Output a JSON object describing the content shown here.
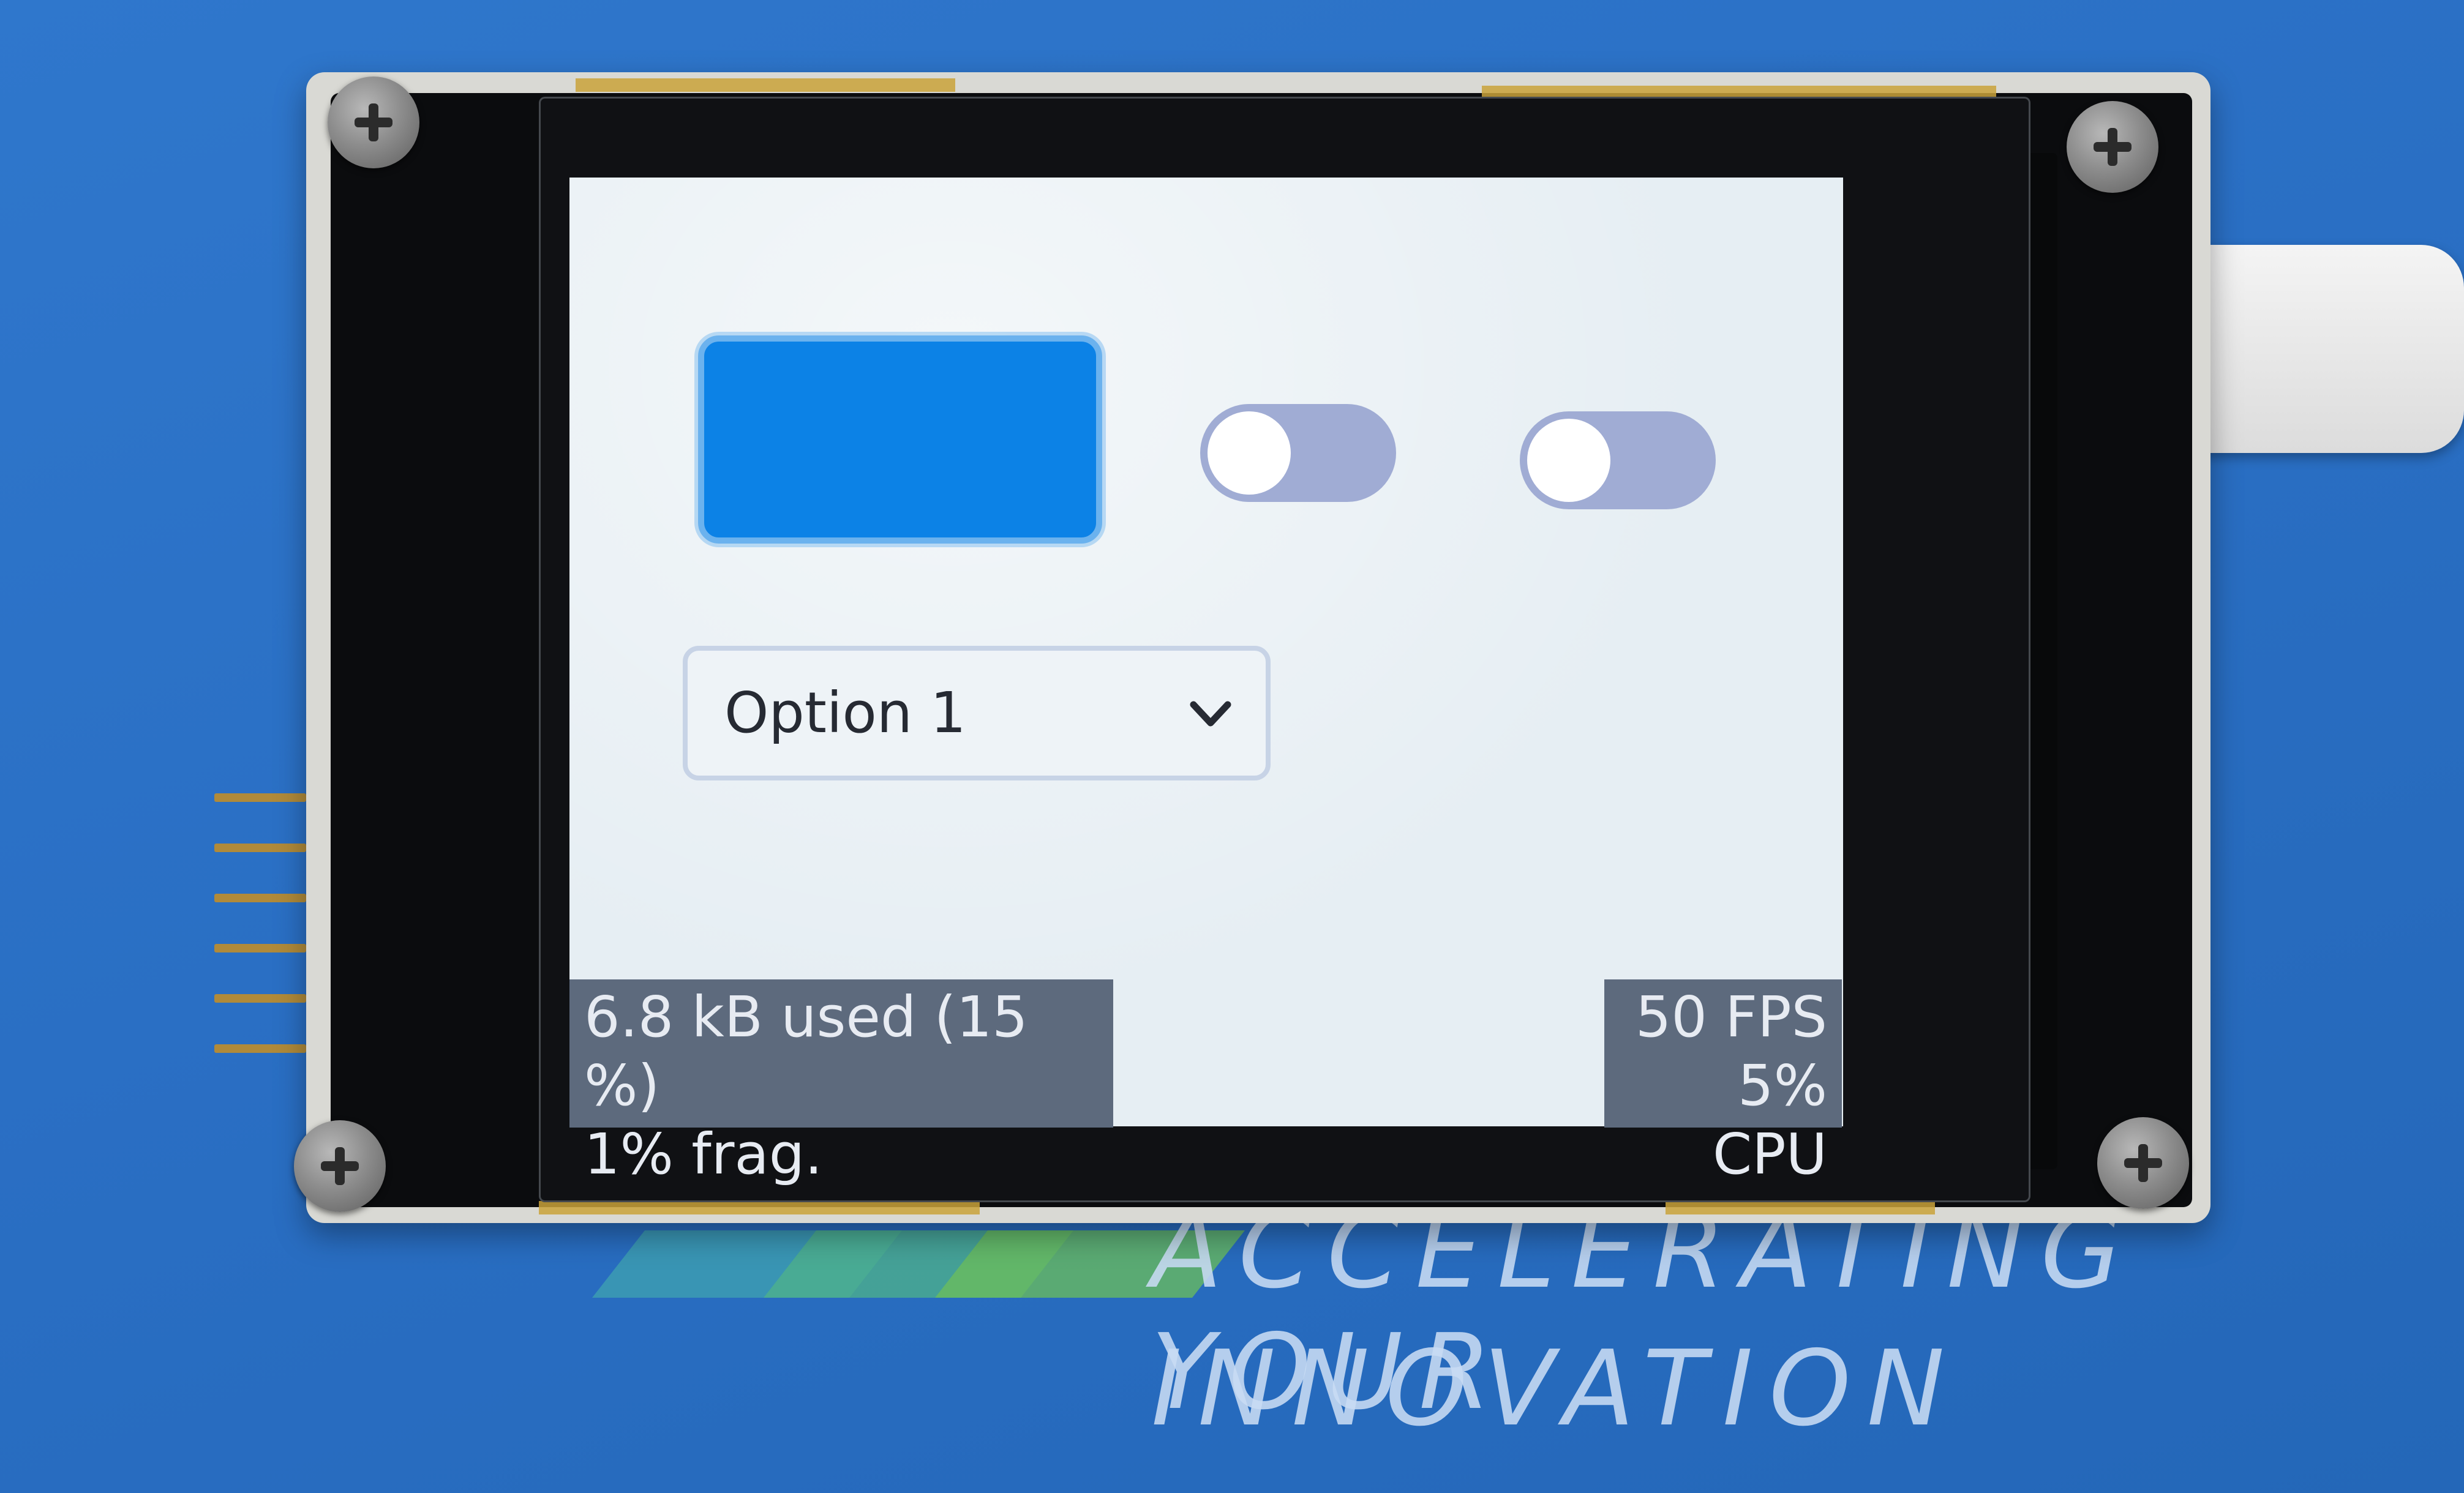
{
  "screen": {
    "dropdown": {
      "selected": "Option 1"
    },
    "memory_monitor": {
      "line1": "6.8 kB used (15 %)",
      "line2": "1% frag."
    },
    "perf_monitor": {
      "line1": "50 FPS",
      "line2": "5% CPU"
    },
    "button": {
      "color": "#0c82e6"
    },
    "switch_1": {
      "state": "off",
      "color": "#a0acd4"
    },
    "switch_2": {
      "state": "off",
      "color": "#a0acd4"
    }
  },
  "background": {
    "slogan_line1": "ACCELERATING YOUR",
    "slogan_line2": "INNOVATION",
    "mat_color": "#2a6fc4"
  },
  "icons": {
    "dropdown_caret": "chevron-down-icon",
    "screw": "phillips-screw-icon"
  }
}
